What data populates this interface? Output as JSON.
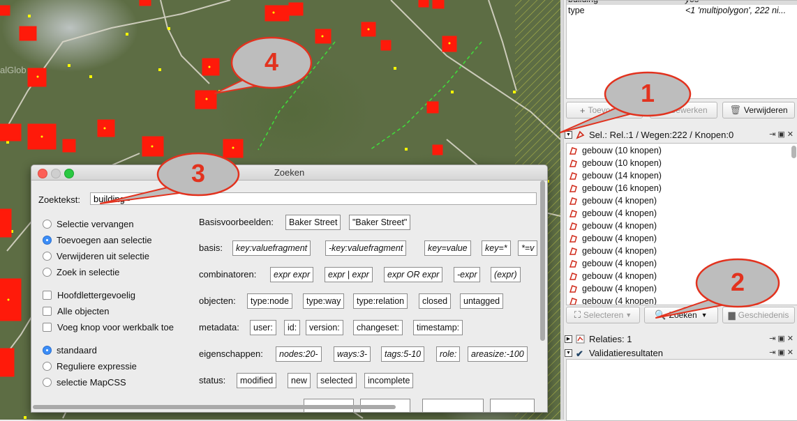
{
  "map": {
    "watermark": "alGlob"
  },
  "callouts": [
    {
      "label": "1"
    },
    {
      "label": "2"
    },
    {
      "label": "3"
    },
    {
      "label": "4"
    }
  ],
  "tags": {
    "row_building": {
      "key": "building",
      "value": "yes"
    },
    "row_type": {
      "key": "type",
      "value": "<1 'multipolygon', 222 ni..."
    },
    "buttons": {
      "add": "Toevoegen",
      "edit": "Bewerken",
      "delete": "Verwijderen"
    }
  },
  "selection": {
    "header": "Sel.: Rel.:1 / Wegen:222 / Knopen:0",
    "items": [
      "gebouw (10 knopen)",
      "gebouw (10 knopen)",
      "gebouw (14 knopen)",
      "gebouw (16 knopen)",
      "gebouw (4 knopen)",
      "gebouw (4 knopen)",
      "gebouw (4 knopen)",
      "gebouw (4 knopen)",
      "gebouw (4 knopen)",
      "gebouw (4 knopen)",
      "gebouw (4 knopen)",
      "gebouw (4 knopen)",
      "gebouw (4 knopen)"
    ],
    "buttons": {
      "select": "Selecteren",
      "search": "Zoeken",
      "history": "Geschiedenis"
    }
  },
  "relations": {
    "header": "Relaties: 1"
  },
  "validation": {
    "header": "Validatieresultaten"
  },
  "colors": {
    "accent": "#3c8df6",
    "callout_text": "#e2321e",
    "callout_fill": "#bdbdbd",
    "callout_border": "#e2321e",
    "building": "#ff1a0a",
    "node": "#ffff00"
  },
  "dialog": {
    "title": "Zoeken",
    "search_label": "Zoektekst:",
    "search_value": "building=*",
    "modes": [
      "Selectie vervangen",
      "Toevoegen aan selectie",
      "Verwijderen uit selectie",
      "Zoek in selectie"
    ],
    "selected_mode": "Toevoegen aan selectie",
    "checks": [
      "Hoofdlettergevoelig",
      "Alle objecten",
      "Voeg knop voor werkbalk toe"
    ],
    "syntax": [
      "standaard",
      "Reguliere expressie",
      "selectie MapCSS"
    ],
    "selected_syntax": "standaard",
    "rows": {
      "basis_examples": {
        "label": "Basisvoorbeelden:",
        "chips": [
          "Baker Street",
          "\"Baker Street\""
        ]
      },
      "basis": {
        "label": "basis:",
        "chips": [
          "key:valuefragment",
          "-key:valuefragment",
          "key=value",
          "key=*",
          "*=v"
        ]
      },
      "combinators": {
        "label": "combinatoren:",
        "chips": [
          "expr expr",
          "expr | expr",
          "expr OR expr",
          "-expr",
          "(expr)"
        ]
      },
      "objects": {
        "label": "objecten:",
        "chips": [
          "type:node",
          "type:way",
          "type:relation",
          "closed",
          "untagged"
        ]
      },
      "metadata": {
        "label": "metadata:",
        "chips": [
          "user:",
          "id:",
          "version:",
          "changeset:",
          "timestamp:"
        ]
      },
      "properties": {
        "label": "eigenschappen:",
        "chips": [
          "nodes:20-",
          "ways:3-",
          "tags:5-10",
          "role:",
          "areasize:-100"
        ]
      },
      "status": {
        "label": "status:",
        "chips": [
          "modified",
          "new",
          "selected",
          "incomplete"
        ]
      }
    }
  }
}
